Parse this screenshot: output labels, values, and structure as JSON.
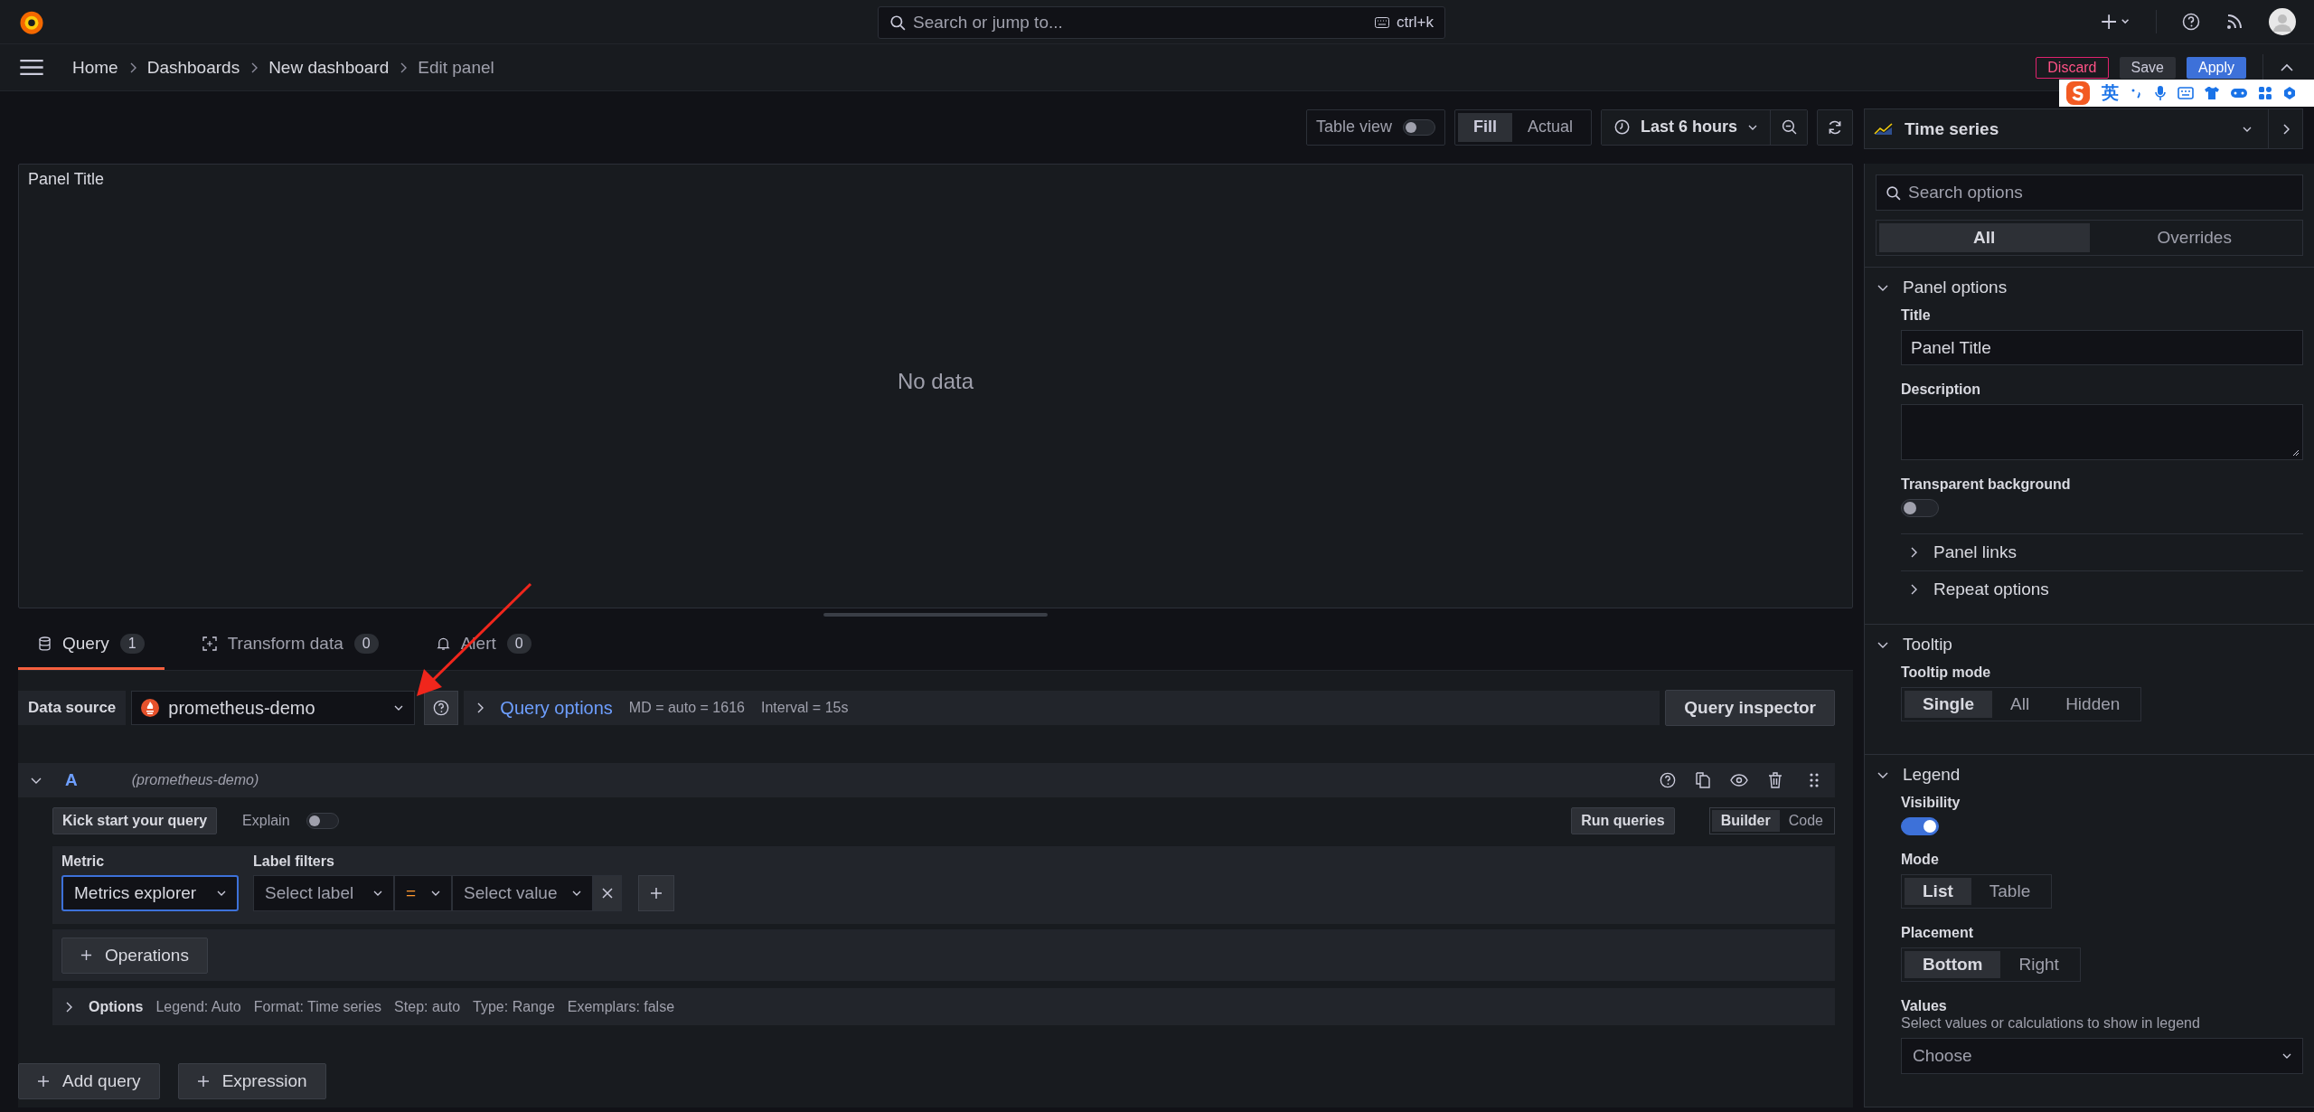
{
  "topbar": {
    "search_placeholder": "Search or jump to...",
    "shortcut": "ctrl+k"
  },
  "breadcrumbs": [
    {
      "label": "Home",
      "current": false
    },
    {
      "label": "Dashboards",
      "current": false
    },
    {
      "label": "New dashboard",
      "current": false
    },
    {
      "label": "Edit panel",
      "current": true
    }
  ],
  "actions": [
    {
      "label": "Discard",
      "kind": "danger"
    },
    {
      "label": "Save",
      "kind": "secondary"
    },
    {
      "label": "Apply",
      "kind": "primary"
    }
  ],
  "ime_toolbar": {
    "language": "英"
  },
  "toolbar": {
    "table_view": {
      "label": "Table view",
      "on": false
    },
    "fill_modes": [
      {
        "label": "Fill",
        "selected": true
      },
      {
        "label": "Actual",
        "selected": false
      }
    ],
    "time_range": "Last 6 hours"
  },
  "visualization": {
    "label": "Time series"
  },
  "panel": {
    "title": "Panel Title",
    "message": "No data"
  },
  "tabs": [
    {
      "label": "Query",
      "count": "1",
      "selected": true
    },
    {
      "label": "Transform data",
      "count": "0",
      "selected": false
    },
    {
      "label": "Alert",
      "count": "0",
      "selected": false
    }
  ],
  "data_source": {
    "label": "Data source",
    "value": "prometheus-demo",
    "query_options": "Query options",
    "query_options_expanded": false,
    "md": "MD = auto = 1616",
    "interval": "Interval = 15s",
    "inspector": "Query inspector"
  },
  "query": {
    "ref": "A",
    "source": "(prometheus-demo)",
    "expanded": true,
    "kick_start": "Kick start your query",
    "explain": {
      "label": "Explain",
      "on": false
    },
    "run": "Run queries",
    "modes": [
      {
        "label": "Builder",
        "selected": true
      },
      {
        "label": "Code",
        "selected": false
      }
    ],
    "metric_label": "Metric",
    "metric_value": "Metrics explorer",
    "label_filters": "Label filters",
    "label_placeholder": "Select label",
    "operator": "=",
    "value_placeholder": "Select value",
    "operations": "Operations",
    "options_label": "Options",
    "options_expanded": false,
    "options_summary": [
      "Legend: Auto",
      "Format: Time series",
      "Step: auto",
      "Type: Range",
      "Exemplars: false"
    ]
  },
  "buttons": [
    "Add query",
    "Expression"
  ],
  "options_pane": {
    "search_placeholder": "Search options",
    "tabs": [
      {
        "label": "All",
        "selected": true
      },
      {
        "label": "Overrides",
        "selected": false
      }
    ],
    "sections": [
      {
        "title": "Panel options",
        "expanded": true,
        "items": [
          {
            "kind": "text",
            "label": "Title",
            "value": "Panel Title"
          },
          {
            "kind": "textarea",
            "label": "Description"
          },
          {
            "kind": "switch",
            "label": "Transparent background",
            "on": false
          },
          {
            "kind": "subsection",
            "label": "Panel links",
            "expanded": false
          },
          {
            "kind": "subsection",
            "label": "Repeat options",
            "expanded": false
          }
        ]
      },
      {
        "title": "Tooltip",
        "expanded": true,
        "items": [
          {
            "kind": "radio",
            "label": "Tooltip mode",
            "options": [
              {
                "label": "Single",
                "selected": true
              },
              {
                "label": "All",
                "selected": false
              },
              {
                "label": "Hidden",
                "selected": false
              }
            ]
          }
        ]
      },
      {
        "title": "Legend",
        "expanded": true,
        "items": [
          {
            "kind": "switch",
            "label": "Visibility",
            "on": true
          },
          {
            "kind": "radio",
            "label": "Mode",
            "options": [
              {
                "label": "List",
                "selected": true
              },
              {
                "label": "Table",
                "selected": false
              }
            ]
          },
          {
            "kind": "radio",
            "label": "Placement",
            "options": [
              {
                "label": "Bottom",
                "selected": true
              },
              {
                "label": "Right",
                "selected": false
              }
            ]
          },
          {
            "kind": "select",
            "label": "Values",
            "description": "Select values or calculations to show in legend",
            "placeholder": "Choose"
          }
        ]
      }
    ]
  }
}
